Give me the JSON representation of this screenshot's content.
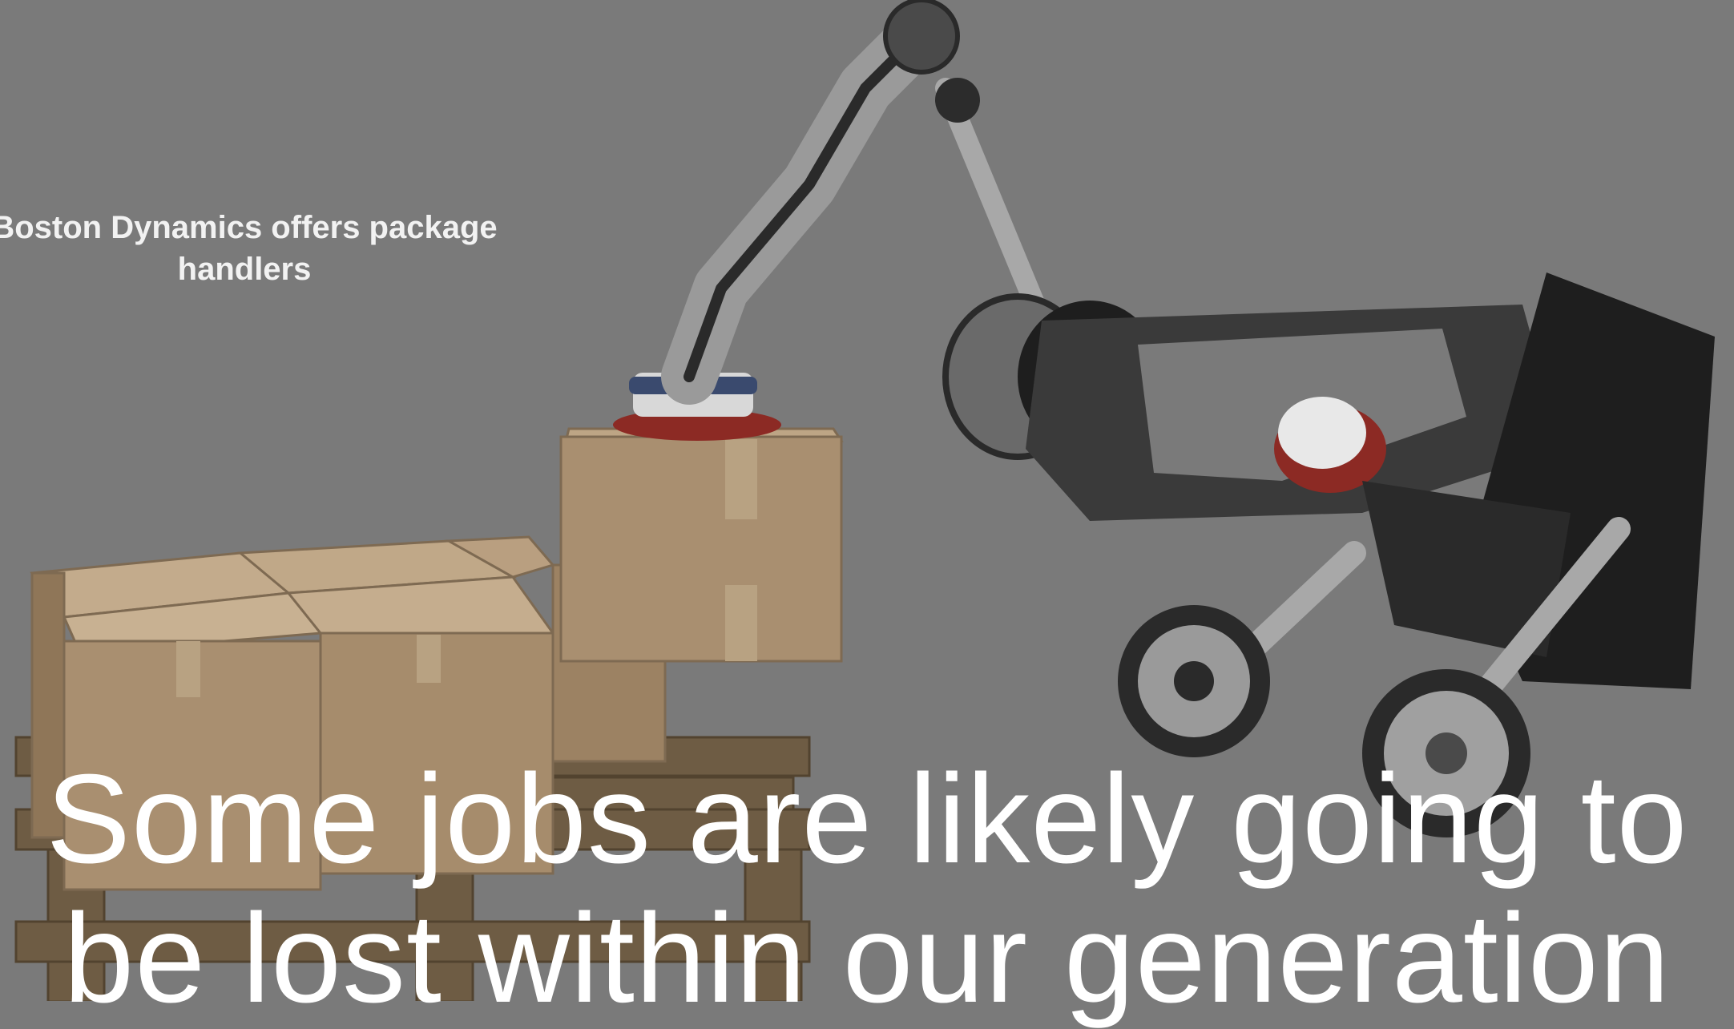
{
  "slide": {
    "caption": "Boston Dynamics offers package handlers",
    "headline": {
      "line1": "Some jobs are likely going to",
      "line2": "be lost within our generation"
    }
  },
  "colors": {
    "background": "#7a7a7a",
    "cardboard": "#a98f70",
    "pallet": "#6e5c44",
    "robot_dark": "#1e1e1e",
    "robot_metal": "#b9b9b9",
    "gripper_red": "#8c2a24"
  },
  "icons": {
    "photo": "robot-handling-boxes-photo"
  }
}
